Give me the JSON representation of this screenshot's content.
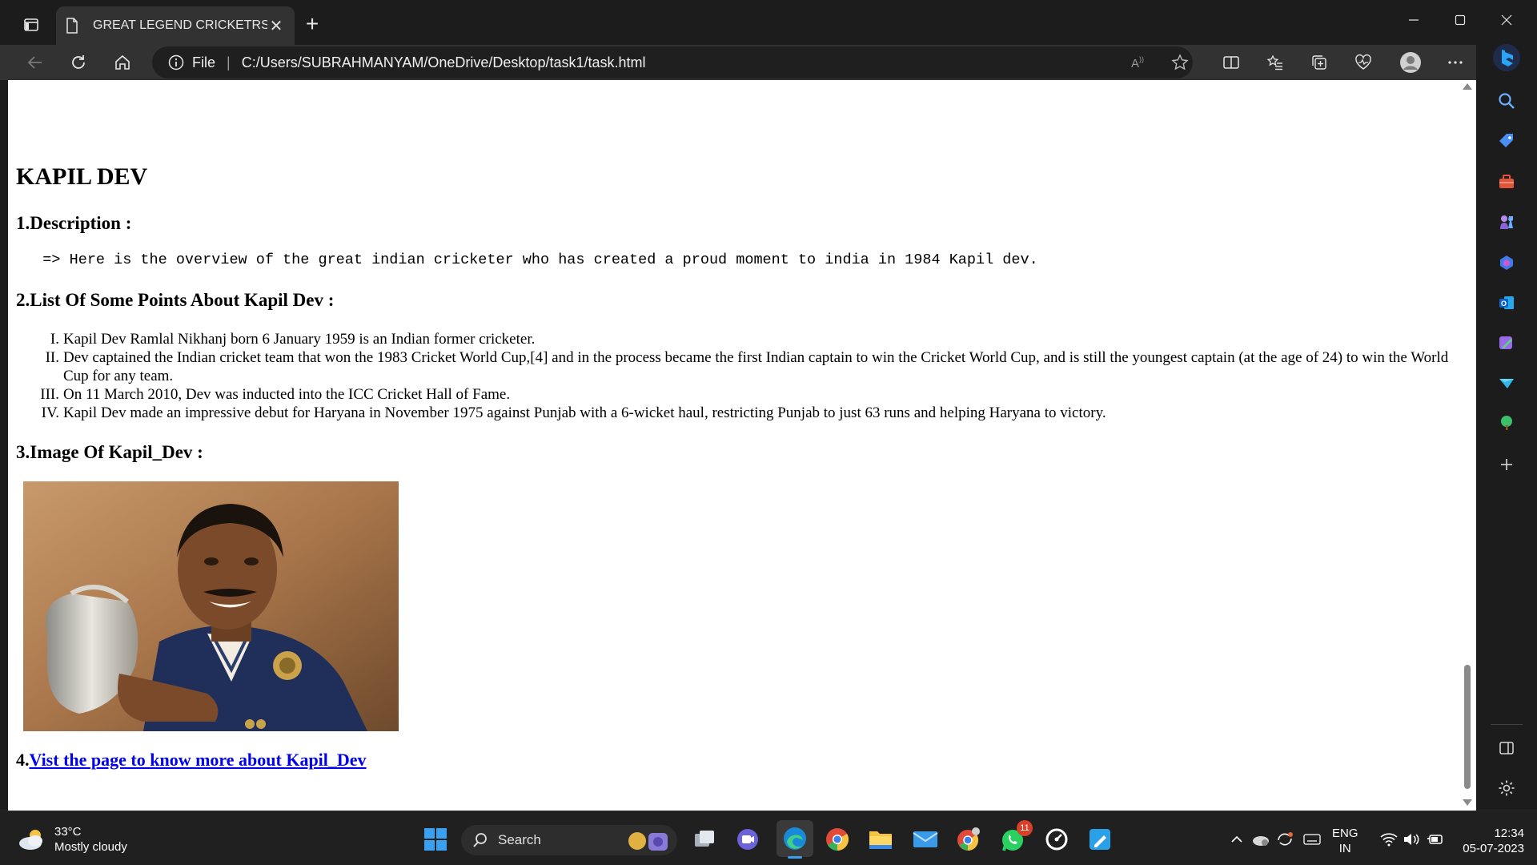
{
  "browser": {
    "tab_title": "GREAT LEGEND CRICKETRS",
    "tab_close": "✕",
    "new_tab": "+",
    "address_scheme": "File",
    "address_separator": "|",
    "address_url": "C:/Users/SUBRAHMANYAM/OneDrive/Desktop/task1/task.html",
    "colors": {
      "frame": "#1c1c1c",
      "toolbar": "#323232",
      "accent": "#0a84ff"
    }
  },
  "page": {
    "heading": "KAPIL DEV",
    "section1_title": "1.Description :",
    "description": "   => Here is the overview of the great indian cricketer who has created a proud moment to india in 1984 Kapil dev.",
    "section2_title": "2.List Of Some Points About Kapil Dev :",
    "points": [
      {
        "num": "I.",
        "text": "Kapil Dev Ramlal Nikhanj born 6 January 1959 is an Indian former cricketer."
      },
      {
        "num": "II.",
        "text": "Dev captained the Indian cricket team that won the 1983 Cricket World Cup,[4] and in the process became the first Indian captain to win the Cricket World Cup, and is still the youngest captain (at the age of 24) to win the World Cup for any team."
      },
      {
        "num": "III.",
        "text": "On 11 March 2010, Dev was inducted into the ICC Cricket Hall of Fame."
      },
      {
        "num": "IV.",
        "text": "Kapil Dev made an impressive debut for Haryana in November 1975 against Punjab with a 6-wicket haul, restricting Punjab to just 63 runs and helping Haryana to victory."
      }
    ],
    "section3_title": "3.Image Of Kapil_Dev :",
    "section4_prefix": "4.",
    "link_text": "Vist the page to know more about Kapil_Dev",
    "link_color": "#0000ee"
  },
  "taskbar": {
    "weather_temp": "33°C",
    "weather_desc": "Mostly cloudy",
    "search_label": "Search",
    "whatsapp_badge": "11",
    "lang_line1": "ENG",
    "lang_line2": "IN",
    "time": "12:34",
    "date": "05-07-2023"
  }
}
